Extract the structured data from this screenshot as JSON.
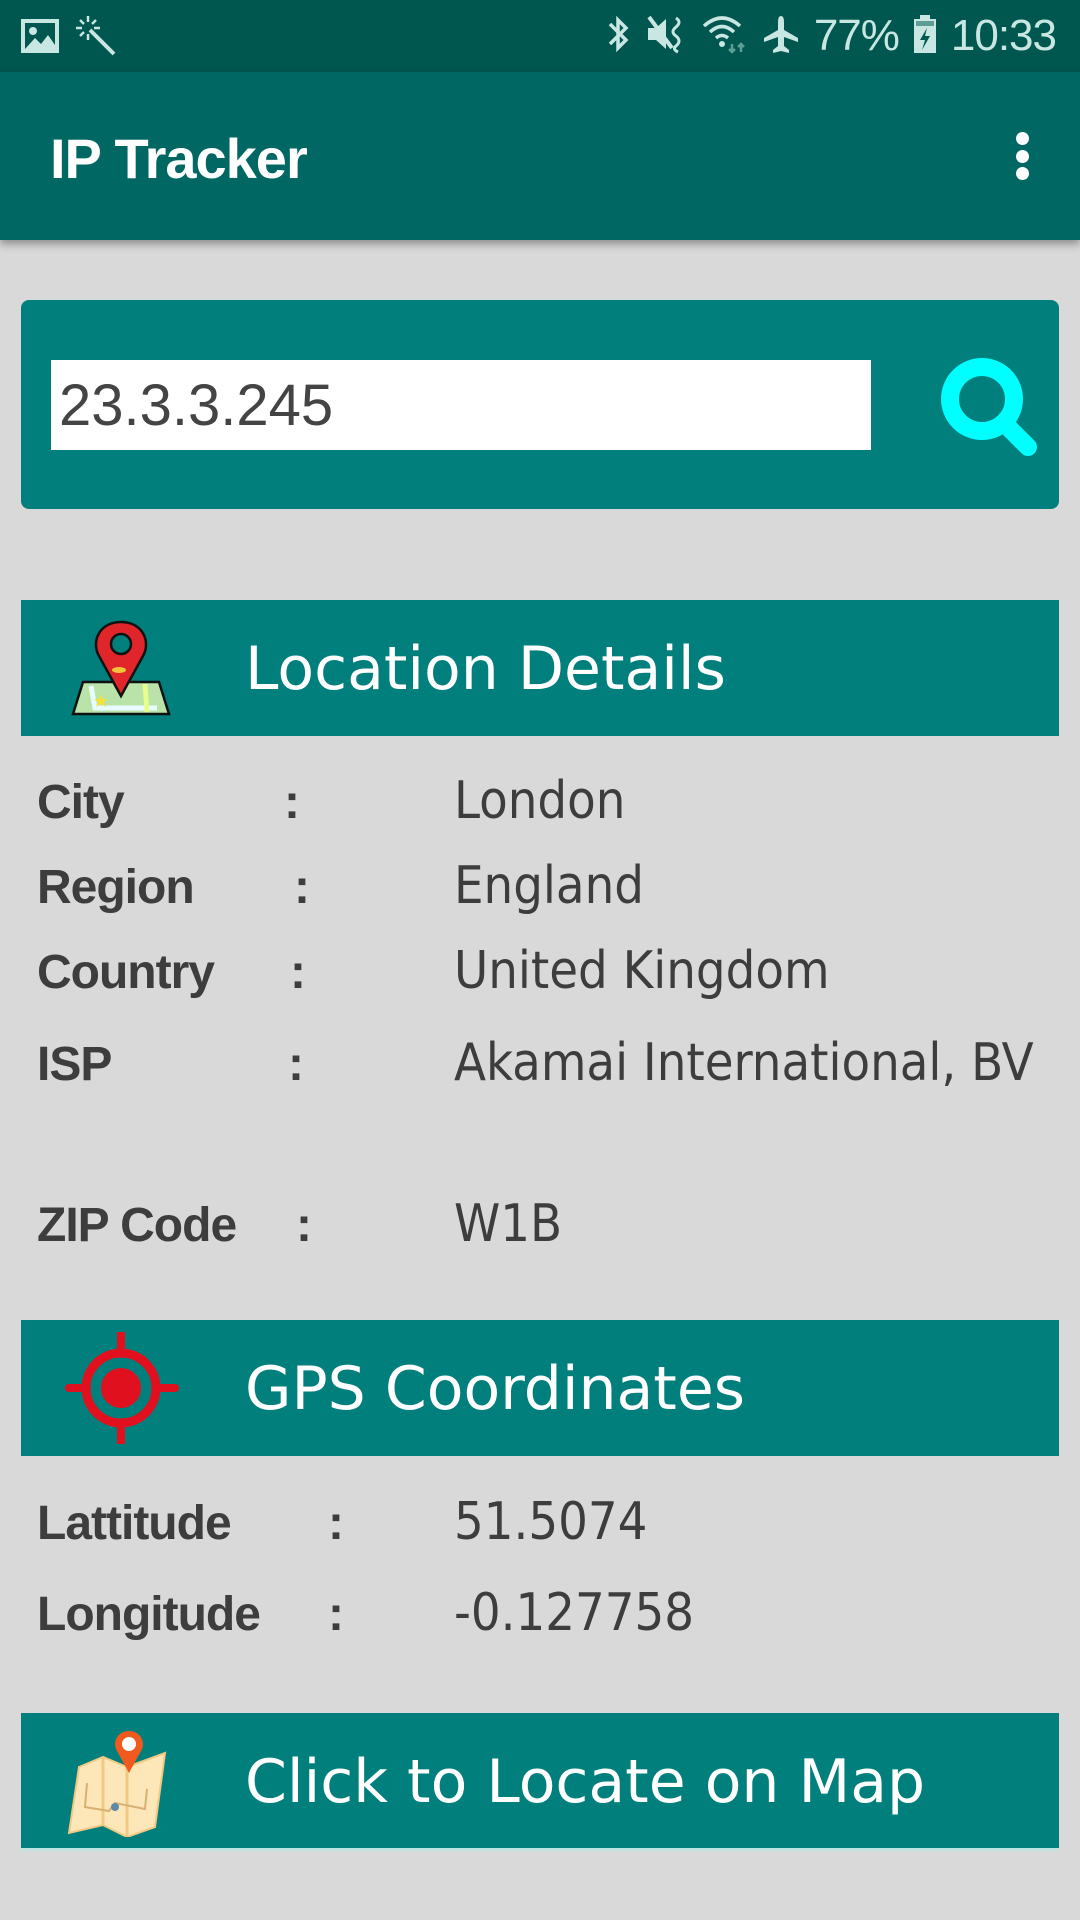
{
  "status_bar": {
    "left_icons": [
      "gallery-icon",
      "magic-wand-icon"
    ],
    "right_icons": [
      "bluetooth-icon",
      "vibrate-mute-icon",
      "wifi-icon",
      "airplane-mode-icon"
    ],
    "battery_percent": "77%",
    "battery_icon": "battery-charging-icon",
    "time": "10:33"
  },
  "app_bar": {
    "title": "IP Tracker",
    "menu_icon": "overflow-menu-icon"
  },
  "search": {
    "value": "23.3.3.245",
    "placeholder": "",
    "button_icon": "search-icon"
  },
  "location_section": {
    "title": "Location Details",
    "icon": "map-pin-icon",
    "rows": [
      {
        "label": "City",
        "colon": ":",
        "value": "London"
      },
      {
        "label": "Region",
        "colon": ":",
        "value": "England"
      },
      {
        "label": "Country",
        "colon": ":",
        "value": "United Kingdom"
      },
      {
        "label": "ISP",
        "colon": ":",
        "value": "Akamai International, BV"
      },
      {
        "label": "ZIP Code",
        "colon": ":",
        "value": "W1B"
      }
    ]
  },
  "gps_section": {
    "title": "GPS Coordinates",
    "icon": "crosshair-icon",
    "rows": [
      {
        "label": "Lattitude",
        "colon": ":",
        "value": "51.5074"
      },
      {
        "label": "Longitude",
        "colon": ":",
        "value": "-0.127758"
      }
    ]
  },
  "map_button": {
    "label": "Click to Locate on Map",
    "icon": "folded-map-icon"
  },
  "colors": {
    "status_bar": "#00574f",
    "app_bar": "#006763",
    "accent_teal": "#007f7c",
    "search_icon": "#00ffff",
    "background": "#d9d9d9",
    "text_dark": "#3d3d3d",
    "marker_red": "#e0101e"
  }
}
